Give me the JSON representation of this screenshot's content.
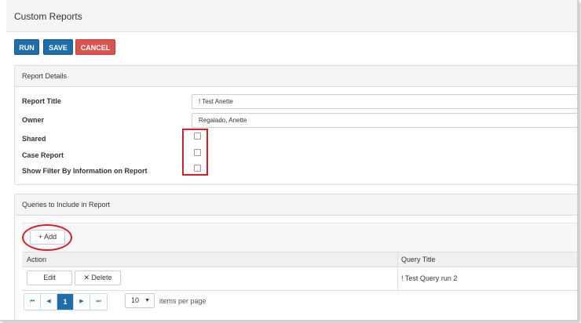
{
  "page": {
    "title": "Custom Reports"
  },
  "toolbar": {
    "run_label": "RUN",
    "save_label": "SAVE",
    "cancel_label": "CANCEL"
  },
  "colors": {
    "primary": "#1f6ea9",
    "danger": "#d9534f",
    "highlight": "#d0202a"
  },
  "report_details": {
    "heading": "Report Details",
    "fields": {
      "report_title": {
        "label": "Report Title",
        "value": "! Test Anette"
      },
      "owner": {
        "label": "Owner",
        "value": "Regalado, Anette"
      },
      "shared": {
        "label": "Shared",
        "checked": false
      },
      "case_report": {
        "label": "Case Report",
        "checked": false
      },
      "show_filter": {
        "label": "Show Filter By Information on Report",
        "checked": false
      }
    }
  },
  "queries": {
    "heading": "Queries to Include in Report",
    "add_icon": "+",
    "add_label": "Add",
    "columns": {
      "action": "Action",
      "query_title": "Query Title"
    },
    "rows": [
      {
        "edit_label": "Edit",
        "delete_icon": "✕",
        "delete_label": "Delete",
        "query_title": "! Test Query run 2"
      }
    ]
  },
  "pagination": {
    "first_icon": "⏮",
    "prev_icon": "◀",
    "current_page": "1",
    "next_icon": "▶",
    "last_icon": "⏭",
    "page_size": "10",
    "page_size_caret": "▼",
    "items_per_page_label": "items per page"
  }
}
